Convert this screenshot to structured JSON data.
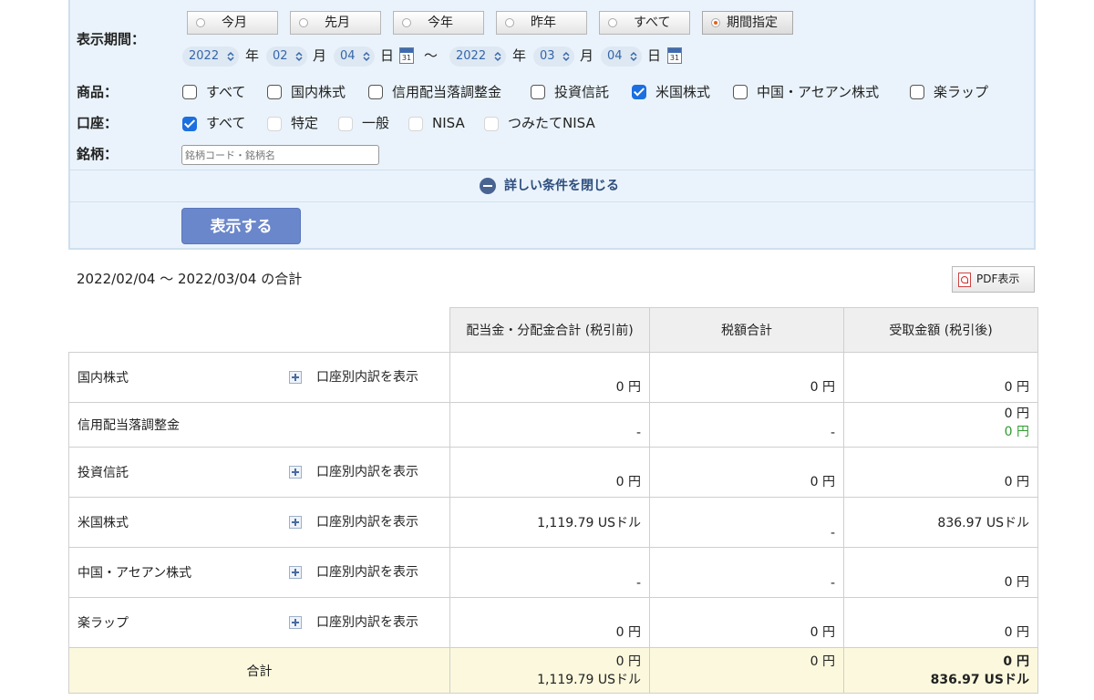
{
  "filter": {
    "period_label": "表示期間：",
    "period_buttons": [
      "今月",
      "先月",
      "今年",
      "昨年",
      "すべて",
      "期間指定"
    ],
    "selected_period": "期間指定",
    "from": {
      "year": "2022",
      "month": "02",
      "day": "04"
    },
    "to": {
      "year": "2022",
      "month": "03",
      "day": "04"
    },
    "unit_year": "年",
    "unit_month": "月",
    "unit_day": "日",
    "range_sep": "〜",
    "calendar_day": "31",
    "product_label": "商品：",
    "products": [
      {
        "label": "すべて",
        "checked": false
      },
      {
        "label": "国内株式",
        "checked": false
      },
      {
        "label": "信用配当落調整金",
        "checked": false
      },
      {
        "label": "投資信託",
        "checked": false
      },
      {
        "label": "米国株式",
        "checked": true
      },
      {
        "label": "中国・アセアン株式",
        "checked": false
      },
      {
        "label": "楽ラップ",
        "checked": false
      }
    ],
    "account_label": "口座：",
    "accounts": [
      {
        "label": "すべて",
        "checked": true
      },
      {
        "label": "特定",
        "checked": false
      },
      {
        "label": "一般",
        "checked": false
      },
      {
        "label": "NISA",
        "checked": false
      },
      {
        "label": "つみたてNISA",
        "checked": false
      }
    ],
    "stock_label": "銘柄：",
    "stock_placeholder": "銘柄コード・銘柄名",
    "close_toggle": "詳しい条件を閉じる",
    "submit": "表示する"
  },
  "summary": {
    "period_text": "2022/02/04 〜 2022/03/04 の合計",
    "pdf_button": "PDF表示",
    "headers": [
      "配当金・分配金合計 (税引前)",
      "税額合計",
      "受取金額 (税引後)"
    ],
    "breakdown_label": "口座別内訳を表示",
    "rows": [
      {
        "name": "国内株式",
        "gross": "0 円",
        "tax": "0 円",
        "net": "0 円",
        "net2": ""
      },
      {
        "name": "信用配当落調整金",
        "gross": "-",
        "tax": "-",
        "net": "0 円",
        "net2": "0 円"
      },
      {
        "name": "投資信託",
        "gross": "0 円",
        "tax": "0 円",
        "net": "0 円",
        "net2": ""
      },
      {
        "name": "米国株式",
        "gross": "1,119.79 USドル",
        "tax": "-",
        "net": "836.97 USドル",
        "net2": ""
      },
      {
        "name": "中国・アセアン株式",
        "gross": "-",
        "tax": "-",
        "net": "0 円",
        "net2": ""
      },
      {
        "name": "楽ラップ",
        "gross": "0 円",
        "tax": "0 円",
        "net": "0 円",
        "net2": ""
      }
    ],
    "total": {
      "label": "合計",
      "gross": "0 円",
      "gross2": "1,119.79 USドル",
      "tax": "0 円",
      "net": "0 円",
      "net2": "836.97 USドル"
    }
  }
}
